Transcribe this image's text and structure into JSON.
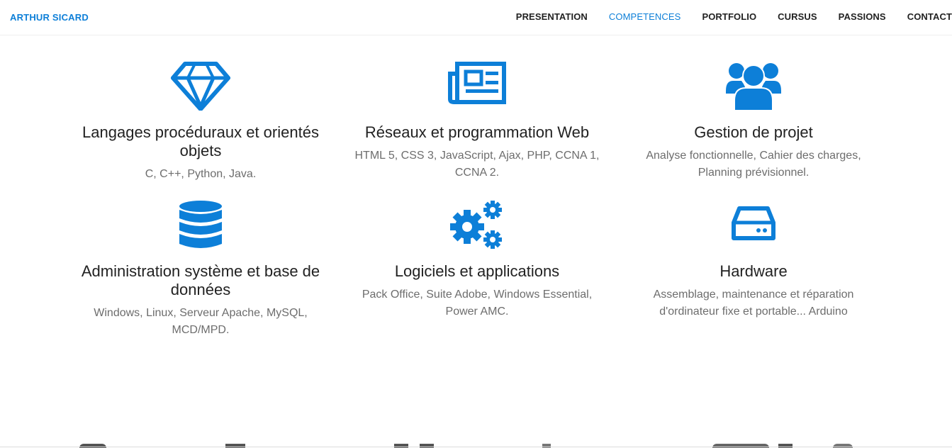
{
  "brand": "ARTHUR SICARD",
  "nav": [
    {
      "label": "PRESENTATION"
    },
    {
      "label": "COMPETENCES",
      "active": true
    },
    {
      "label": "PORTFOLIO"
    },
    {
      "label": "CURSUS"
    },
    {
      "label": "PASSIONS"
    },
    {
      "label": "CONTACT"
    }
  ],
  "skills": [
    {
      "title": "Langages procéduraux et orientés objets",
      "desc": "C, C++, Python, Java.",
      "icon": "diamond-icon"
    },
    {
      "title": "Réseaux et programmation Web",
      "desc": "HTML 5, CSS 3, JavaScript, Ajax, PHP, CCNA 1, CCNA 2.",
      "icon": "newspaper-icon"
    },
    {
      "title": "Gestion de projet",
      "desc": "Analyse fonctionnelle, Cahier des charges, Planning prévisionnel.",
      "icon": "users-icon"
    },
    {
      "title": "Administration système et base de données",
      "desc": "Windows, Linux, Serveur Apache, MySQL, MCD/MPD.",
      "icon": "database-icon"
    },
    {
      "title": "Logiciels et applications",
      "desc": "Pack Office, Suite Adobe, Windows Essential, Power AMC.",
      "icon": "cogs-icon"
    },
    {
      "title": "Hardware",
      "desc": "Assemblage, maintenance et réparation d'ordinateur fixe et portable... Arduino",
      "icon": "hdd-icon"
    }
  ],
  "colors": {
    "accent": "#0d7fd8",
    "text": "#222222",
    "muted": "#6d6d6d"
  }
}
